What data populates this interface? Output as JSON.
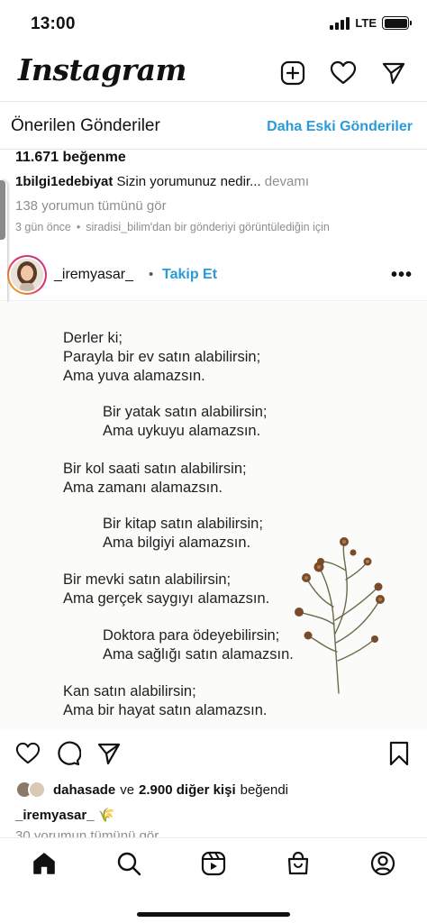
{
  "status": {
    "time": "13:00",
    "network": "LTE"
  },
  "header": {
    "logo": "Instagram"
  },
  "suggested": {
    "title": "Önerilen Gönderiler",
    "older_link": "Daha Eski Gönderiler"
  },
  "previous_post": {
    "likes": "11.671 beğenme",
    "caption_user": "1bilgi1edebiyat",
    "caption_text": "Sizin yorumunuz nedir...",
    "caption_more": "devamı",
    "comments_link": "138 yorumun tümünü gör",
    "time": "3 gün önce",
    "reason": "siradisi_bilim'dan bir gönderiyi görüntülediğin için"
  },
  "post": {
    "username": "_iremyasar_",
    "follow_label": "Takip Et",
    "poem": [
      "Derler ki;",
      "Parayla bir ev satın alabilirsin;",
      "Ama yuva alamazsın.",
      "Bir yatak satın alabilirsin;",
      "Ama uykuyu alamazsın.",
      "Bir kol saati satın alabilirsin;",
      "Ama zamanı alamazsın.",
      "Bir kitap satın alabilirsin;",
      "Ama bilgiyi alamazsın.",
      "Bir mevki satın alabilirsin;",
      "Ama gerçek saygıyı alamazsın.",
      "Doktora para ödeyebilirsin;",
      "Ama sağlığı satın alamazsın.",
      "Kan satın alabilirsin;",
      "Ama bir hayat satın alamazsın."
    ],
    "liked_by_user": "dahasade",
    "liked_by_and": "ve",
    "liked_by_others": "2.900 diğer kişi",
    "liked_by_suffix": "beğendi",
    "owner_caption": "_iremyasar_",
    "owner_emoji": "🌾",
    "comments_partial": "30 yorumun tümünü gör"
  },
  "icons": {
    "new_post": "plus-square-icon",
    "activity": "heart-icon",
    "direct": "paper-plane-icon",
    "like": "heart-icon",
    "comment": "comment-icon",
    "share": "paper-plane-icon",
    "save": "bookmark-icon",
    "tabs": [
      "home-icon",
      "search-icon",
      "reels-icon",
      "shop-icon",
      "profile-icon"
    ]
  },
  "colors": {
    "link_blue": "#2a9bd8",
    "muted": "#8e8e8e",
    "text": "#111111"
  }
}
